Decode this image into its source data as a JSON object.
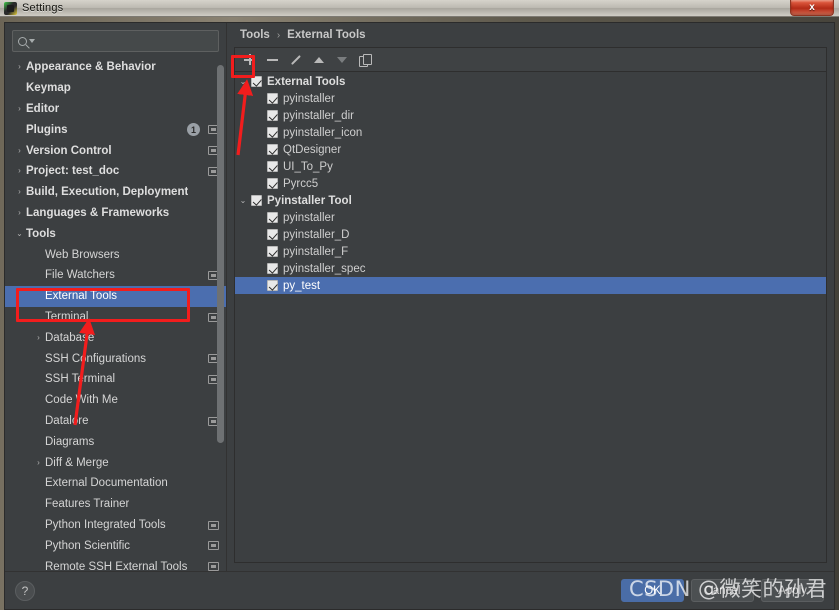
{
  "window": {
    "title": "Settings",
    "icon": "app-icon",
    "close_label": "x"
  },
  "search": {
    "value": "",
    "placeholder": "",
    "icon": "search-icon"
  },
  "sidebar": {
    "items": [
      {
        "label": "Appearance & Behavior",
        "arrow": "›",
        "bold": true,
        "indent": 0,
        "badge": null,
        "square": false,
        "selected": false
      },
      {
        "label": "Keymap",
        "arrow": "",
        "bold": true,
        "indent": 0,
        "badge": null,
        "square": false,
        "selected": false
      },
      {
        "label": "Editor",
        "arrow": "›",
        "bold": true,
        "indent": 0,
        "badge": null,
        "square": false,
        "selected": false
      },
      {
        "label": "Plugins",
        "arrow": "",
        "bold": true,
        "indent": 0,
        "badge": "1",
        "square": true,
        "selected": false
      },
      {
        "label": "Version Control",
        "arrow": "›",
        "bold": true,
        "indent": 0,
        "badge": null,
        "square": true,
        "selected": false
      },
      {
        "label": "Project: test_doc",
        "arrow": "›",
        "bold": true,
        "indent": 0,
        "badge": null,
        "square": true,
        "selected": false
      },
      {
        "label": "Build, Execution, Deployment",
        "arrow": "›",
        "bold": true,
        "indent": 0,
        "badge": null,
        "square": false,
        "selected": false
      },
      {
        "label": "Languages & Frameworks",
        "arrow": "›",
        "bold": true,
        "indent": 0,
        "badge": null,
        "square": false,
        "selected": false
      },
      {
        "label": "Tools",
        "arrow": "⌄",
        "bold": true,
        "indent": 0,
        "badge": null,
        "square": false,
        "selected": false
      },
      {
        "label": "Web Browsers",
        "arrow": "",
        "bold": false,
        "indent": 1,
        "badge": null,
        "square": false,
        "selected": false
      },
      {
        "label": "File Watchers",
        "arrow": "",
        "bold": false,
        "indent": 1,
        "badge": null,
        "square": true,
        "selected": false
      },
      {
        "label": "External Tools",
        "arrow": "",
        "bold": false,
        "indent": 1,
        "badge": null,
        "square": false,
        "selected": true
      },
      {
        "label": "Terminal",
        "arrow": "",
        "bold": false,
        "indent": 1,
        "badge": null,
        "square": true,
        "selected": false
      },
      {
        "label": "Database",
        "arrow": "›",
        "bold": false,
        "indent": 1,
        "badge": null,
        "square": false,
        "selected": false
      },
      {
        "label": "SSH Configurations",
        "arrow": "",
        "bold": false,
        "indent": 1,
        "badge": null,
        "square": true,
        "selected": false
      },
      {
        "label": "SSH Terminal",
        "arrow": "",
        "bold": false,
        "indent": 1,
        "badge": null,
        "square": true,
        "selected": false
      },
      {
        "label": "Code With Me",
        "arrow": "",
        "bold": false,
        "indent": 1,
        "badge": null,
        "square": false,
        "selected": false
      },
      {
        "label": "Datalore",
        "arrow": "",
        "bold": false,
        "indent": 1,
        "badge": null,
        "square": true,
        "selected": false
      },
      {
        "label": "Diagrams",
        "arrow": "",
        "bold": false,
        "indent": 1,
        "badge": null,
        "square": false,
        "selected": false
      },
      {
        "label": "Diff & Merge",
        "arrow": "›",
        "bold": false,
        "indent": 1,
        "badge": null,
        "square": false,
        "selected": false
      },
      {
        "label": "External Documentation",
        "arrow": "",
        "bold": false,
        "indent": 1,
        "badge": null,
        "square": false,
        "selected": false
      },
      {
        "label": "Features Trainer",
        "arrow": "",
        "bold": false,
        "indent": 1,
        "badge": null,
        "square": false,
        "selected": false
      },
      {
        "label": "Python Integrated Tools",
        "arrow": "",
        "bold": false,
        "indent": 1,
        "badge": null,
        "square": true,
        "selected": false
      },
      {
        "label": "Python Scientific",
        "arrow": "",
        "bold": false,
        "indent": 1,
        "badge": null,
        "square": true,
        "selected": false
      },
      {
        "label": "Remote SSH External Tools",
        "arrow": "",
        "bold": false,
        "indent": 1,
        "badge": null,
        "square": true,
        "selected": false
      }
    ]
  },
  "breadcrumb": {
    "root": "Tools",
    "separator": "›",
    "current": "External Tools"
  },
  "toolbar": {
    "buttons": [
      {
        "name": "add-button",
        "icon": "plus-icon",
        "enabled": true
      },
      {
        "name": "remove-button",
        "icon": "minus-icon",
        "enabled": true
      },
      {
        "name": "edit-button",
        "icon": "pencil-icon",
        "enabled": true
      },
      {
        "name": "move-up-button",
        "icon": "arrow-up-icon",
        "enabled": true
      },
      {
        "name": "move-down-button",
        "icon": "arrow-down-icon",
        "enabled": false
      },
      {
        "name": "copy-button",
        "icon": "copy-icon",
        "enabled": true
      }
    ]
  },
  "tool_tree": {
    "rows": [
      {
        "label": "External Tools",
        "group": true,
        "arrow": "⌄",
        "checked": true,
        "indent": 0,
        "selected": false
      },
      {
        "label": "pyinstaller",
        "group": false,
        "arrow": "",
        "checked": true,
        "indent": 1,
        "selected": false
      },
      {
        "label": "pyinstaller_dir",
        "group": false,
        "arrow": "",
        "checked": true,
        "indent": 1,
        "selected": false
      },
      {
        "label": "pyinstaller_icon",
        "group": false,
        "arrow": "",
        "checked": true,
        "indent": 1,
        "selected": false
      },
      {
        "label": "QtDesigner",
        "group": false,
        "arrow": "",
        "checked": true,
        "indent": 1,
        "selected": false
      },
      {
        "label": "UI_To_Py",
        "group": false,
        "arrow": "",
        "checked": true,
        "indent": 1,
        "selected": false
      },
      {
        "label": "Pyrcc5",
        "group": false,
        "arrow": "",
        "checked": true,
        "indent": 1,
        "selected": false
      },
      {
        "label": "Pyinstaller Tool",
        "group": true,
        "arrow": "⌄",
        "checked": true,
        "indent": 0,
        "selected": false
      },
      {
        "label": "pyinstaller",
        "group": false,
        "arrow": "",
        "checked": true,
        "indent": 1,
        "selected": false
      },
      {
        "label": "pyinstaller_D",
        "group": false,
        "arrow": "",
        "checked": true,
        "indent": 1,
        "selected": false
      },
      {
        "label": "pyinstaller_F",
        "group": false,
        "arrow": "",
        "checked": true,
        "indent": 1,
        "selected": false
      },
      {
        "label": "pyinstaller_spec",
        "group": false,
        "arrow": "",
        "checked": true,
        "indent": 1,
        "selected": false
      },
      {
        "label": "py_test",
        "group": false,
        "arrow": "",
        "checked": true,
        "indent": 1,
        "selected": true
      }
    ]
  },
  "footer": {
    "help_label": "?",
    "buttons": [
      {
        "label": "OK",
        "primary": true
      },
      {
        "label": "Cancel",
        "primary": false
      },
      {
        "label": "Apply",
        "primary": false
      }
    ]
  },
  "watermark": {
    "text": "CSDN @微笑的孙君"
  },
  "annotations": {
    "accent_color": "#f21d1d",
    "sidebar_highlight_target": "External Tools",
    "toolbar_highlight_target": "plus-icon"
  }
}
